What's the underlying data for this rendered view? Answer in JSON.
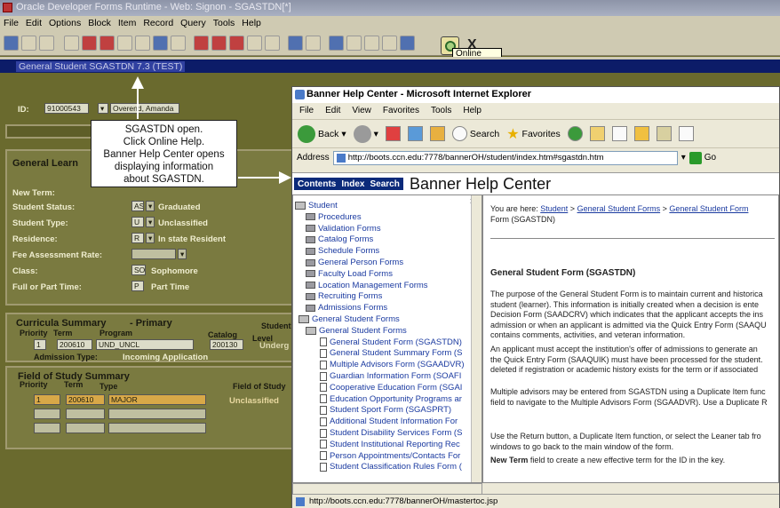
{
  "oracle": {
    "title": "Oracle Developer Forms Runtime - Web: Signon - SGASTDN[*]",
    "menu": [
      "File",
      "Edit",
      "Options",
      "Block",
      "Item",
      "Record",
      "Query",
      "Tools",
      "Help"
    ],
    "online_help_tooltip": "Online Help",
    "exit_label": "X",
    "form_title": "General Student SGASTDN 7.3 (TEST)",
    "id_label": "ID:",
    "id_value": "91000543",
    "name_value": "Overend, Amanda A",
    "panel_title": "General Learn",
    "labels": {
      "new_term": "New Term:",
      "student_status": "Student Status:",
      "student_type": "Student Type:",
      "residence": "Residence:",
      "fee_assessment": "Fee Assessment Rate:",
      "class": "Class:",
      "full_part": "Full or Part Time:"
    },
    "values": {
      "status_code": "AS",
      "status_desc": "Graduated",
      "type_code": "U",
      "type_desc": "Unclassified",
      "res_code": "R",
      "res_desc": "In state Resident",
      "class_code": "SO",
      "class_desc": "Sophomore",
      "fp_code": "P",
      "fp_desc": "Part Time"
    },
    "curricula": {
      "title": "Curricula Summary",
      "subtitle": "- Primary",
      "hdr_priority": "Priority",
      "hdr_term": "Term",
      "hdr_program": "Program",
      "hdr_catalog": "Catalog",
      "hdr_level": "Level",
      "hdr_student": "Student",
      "row_priority": "1",
      "row_term": "200610",
      "row_program": "UND_UNCL",
      "row_catalog": "200130",
      "row_level": "Underg",
      "admission_label": "Admission Type:",
      "admission_value": "Incoming Application"
    },
    "field_of_study": {
      "title": "Field of Study Summary",
      "hdr_priority": "Priority",
      "hdr_term": "Term",
      "hdr_type": "Type",
      "hdr_field": "Field of Study",
      "row_priority": "1",
      "row_term": "200610",
      "row_type": "MAJOR",
      "row_field": "Unclassified"
    }
  },
  "callout": {
    "line1": "SGASTDN open.",
    "line2": "Click Online Help.",
    "line3": "Banner Help Center opens",
    "line4": "displaying information",
    "line5": "about SGASTDN."
  },
  "ie": {
    "title": "Banner Help Center - Microsoft Internet Explorer",
    "menu": [
      "File",
      "Edit",
      "View",
      "Favorites",
      "Tools",
      "Help"
    ],
    "toolbar": {
      "back": "Back",
      "search": "Search",
      "favorites": "Favorites"
    },
    "address_label": "Address",
    "address_value": "http://boots.ccn.edu:7778/bannerOH/student/index.htm#sgastdn.htm",
    "go_label": "Go",
    "status_url": "http://boots.ccn.edu:7778/bannerOH/mastertoc.jsp"
  },
  "banner": {
    "tabs": [
      "Contents",
      "Index",
      "Search"
    ],
    "title": "Banner Help Center",
    "toc": [
      {
        "label": "Student",
        "icon": "folder-open"
      },
      {
        "label": "Procedures",
        "icon": "book"
      },
      {
        "label": "Validation Forms",
        "icon": "book"
      },
      {
        "label": "Catalog Forms",
        "icon": "book"
      },
      {
        "label": "Schedule Forms",
        "icon": "book"
      },
      {
        "label": "General Person Forms",
        "icon": "book"
      },
      {
        "label": "Faculty Load Forms",
        "icon": "book"
      },
      {
        "label": "Location Management Forms",
        "icon": "book"
      },
      {
        "label": "Recruiting Forms",
        "icon": "book"
      },
      {
        "label": "Admissions Forms",
        "icon": "book"
      },
      {
        "label": "General Student Forms",
        "icon": "book-open"
      },
      {
        "label": "General Student Forms",
        "icon": "folder-open"
      },
      {
        "label": "General Student Form  (SGASTDN)",
        "icon": "doc"
      },
      {
        "label": "General Student Summary Form  (S",
        "icon": "doc"
      },
      {
        "label": "Multiple Advisors Form  (SGAADVR)",
        "icon": "doc"
      },
      {
        "label": "Guardian Information Form  (SOAFI",
        "icon": "doc"
      },
      {
        "label": "Cooperative Education Form  (SGAI",
        "icon": "doc"
      },
      {
        "label": "Education Opportunity Programs ar",
        "icon": "doc"
      },
      {
        "label": "Student Sport Form  (SGASPRT)",
        "icon": "doc"
      },
      {
        "label": "Additional Student Information For",
        "icon": "doc"
      },
      {
        "label": "Student Disability Services Form  (S",
        "icon": "doc"
      },
      {
        "label": "Student Institutional Reporting Rec",
        "icon": "doc"
      },
      {
        "label": "Person Appointments/Contacts For",
        "icon": "doc"
      },
      {
        "label": "Student Classification Rules Form  (",
        "icon": "doc"
      }
    ],
    "breadcrumb_prefix": "You are here:",
    "breadcrumb_1": "Student",
    "breadcrumb_sep": ">",
    "breadcrumb_2": "General Student Forms",
    "breadcrumb_3": "General Student Form",
    "breadcrumb_tail": "Form (SGASTDN)",
    "heading": "General Student Form (SGASTDN)",
    "paragraphs": [
      [
        "The purpose of the General Student Form is to maintain current and historica",
        "student (learner). This information is initially created when a decision is ente",
        "Decision Form (SAADCRV) which indicates that the applicant accepts the ins",
        "admission or when an applicant is admitted via the Quick Entry Form (SAAQU",
        "contains comments, activities, and veteran information."
      ],
      [
        "An applicant must accept the institution's offer of admissions to generate an",
        "the Quick Entry Form (SAAQUIK) must have been processed for the student.",
        "deleted if registration or academic history exists for the term or if associated"
      ],
      [
        "Multiple advisors may be entered from SGASTDN using a Duplicate Item func",
        "field to navigate to the Multiple Advisors Form (SGAADVR). Use a Duplicate R"
      ],
      [
        "Use the Return button, a Duplicate Item function, or select the Leaner tab fro",
        "windows to go back to the main window of the form."
      ]
    ],
    "new_term_bold": "New Term",
    "new_term_rest": " field to create a new effective term for the ID in the key."
  }
}
